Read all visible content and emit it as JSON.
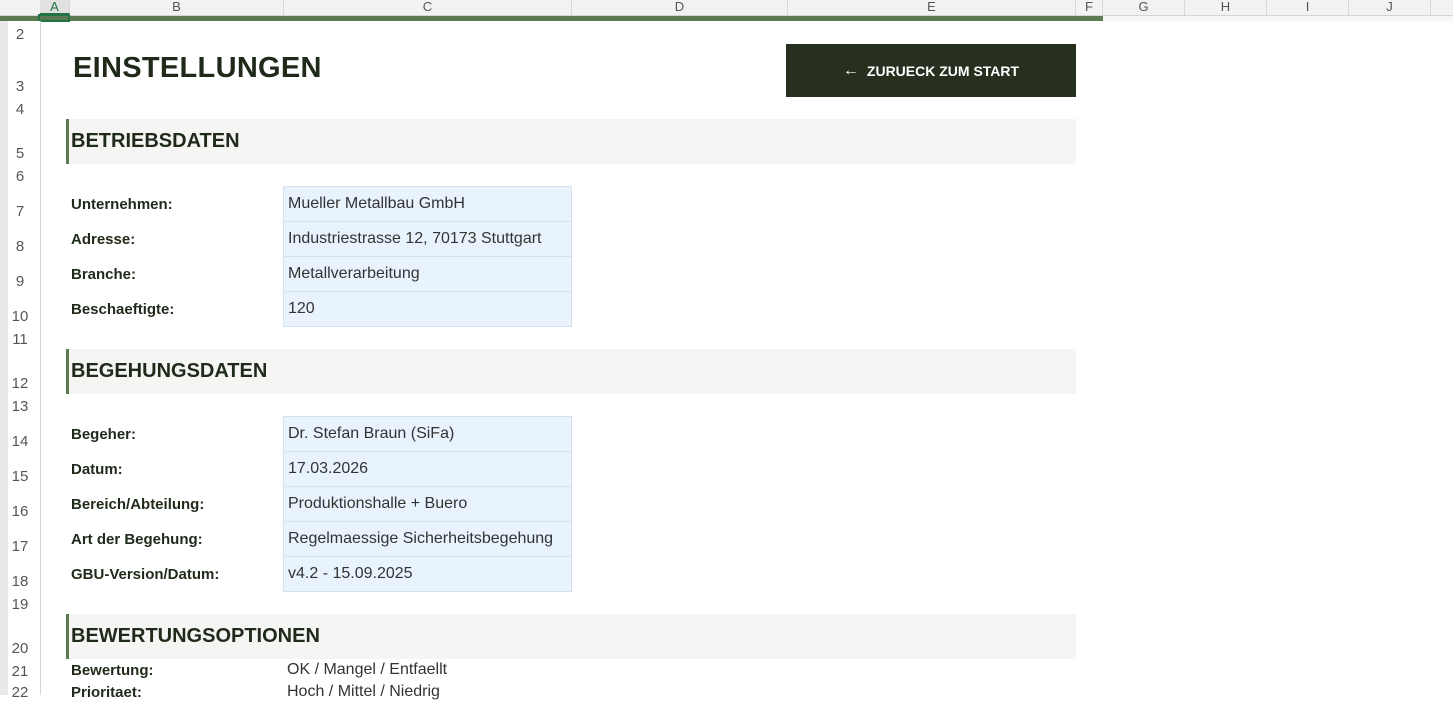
{
  "columns": [
    "A",
    "B",
    "C",
    "D",
    "E",
    "F",
    "G",
    "H",
    "I",
    "J"
  ],
  "rows": [
    "2",
    "3",
    "4",
    "5",
    "6",
    "7",
    "8",
    "9",
    "10",
    "11",
    "12",
    "13",
    "14",
    "15",
    "16",
    "17",
    "18",
    "19",
    "20",
    "21",
    "22"
  ],
  "title": "EINSTELLUNGEN",
  "back_button": {
    "label": "ZURUECK ZUM START",
    "icon": "arrow-left-icon"
  },
  "sections": {
    "betrieb": {
      "heading": "BETRIEBSDATEN",
      "fields": [
        {
          "label": "Unternehmen:",
          "value": "Mueller Metallbau GmbH"
        },
        {
          "label": "Adresse:",
          "value": "Industriestrasse 12, 70173 Stuttgart"
        },
        {
          "label": "Branche:",
          "value": "Metallverarbeitung"
        },
        {
          "label": "Beschaeftigte:",
          "value": "120"
        }
      ]
    },
    "begehung": {
      "heading": "BEGEHUNGSDATEN",
      "fields": [
        {
          "label": "Begeher:",
          "value": "Dr. Stefan Braun (SiFa)"
        },
        {
          "label": "Datum:",
          "value": "17.03.2026"
        },
        {
          "label": "Bereich/Abteilung:",
          "value": "Produktionshalle + Buero"
        },
        {
          "label": "Art der Begehung:",
          "value": "Regelmaessige Sicherheitsbegehung"
        },
        {
          "label": "GBU-Version/Datum:",
          "value": "v4.2 - 15.09.2025"
        }
      ]
    },
    "bewertung": {
      "heading": "BEWERTUNGSOPTIONEN",
      "fields": [
        {
          "label": "Bewertung:",
          "value": "OK / Mangel / Entfaellt"
        },
        {
          "label": "Prioritaet:",
          "value": "Hoch / Mittel / Niedrig"
        }
      ]
    }
  },
  "colors": {
    "accent": "#5c7a52",
    "button_bg": "#27301f",
    "input_bg": "#e8f3fd",
    "section_bg": "#f5f5f3"
  }
}
